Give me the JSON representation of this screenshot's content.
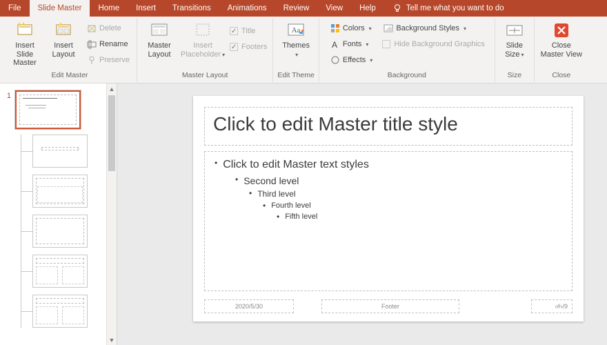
{
  "tabs": {
    "file": "File",
    "slide_master": "Slide Master",
    "home": "Home",
    "insert": "Insert",
    "transitions": "Transitions",
    "animations": "Animations",
    "review": "Review",
    "view": "View",
    "help": "Help",
    "tell_me": "Tell me what you want to do"
  },
  "ribbon": {
    "edit_master": {
      "label": "Edit Master",
      "insert_slide_master": "Insert Slide\nMaster",
      "insert_layout": "Insert\nLayout",
      "delete": "Delete",
      "rename": "Rename",
      "preserve": "Preserve"
    },
    "master_layout": {
      "label": "Master Layout",
      "master_layout_btn": "Master\nLayout",
      "insert_placeholder": "Insert\nPlaceholder",
      "title_chk": "Title",
      "footers_chk": "Footers"
    },
    "edit_theme": {
      "label": "Edit Theme",
      "themes": "Themes"
    },
    "background": {
      "label": "Background",
      "colors": "Colors",
      "fonts": "Fonts",
      "effects": "Effects",
      "bg_styles": "Background Styles",
      "hide_bg": "Hide Background Graphics"
    },
    "size": {
      "label": "Size",
      "slide_size": "Slide\nSize"
    },
    "close": {
      "label": "Close",
      "close_master": "Close\nMaster View"
    }
  },
  "thumbnails": {
    "master_index": "1"
  },
  "slide": {
    "title_ph": "Click to edit Master title style",
    "body_l1": "Click to edit Master text styles",
    "body_l2": "Second level",
    "body_l3": "Third level",
    "body_l4": "Fourth level",
    "body_l5": "Fifth level",
    "date_ph": "2020/5/30",
    "footer_ph": "Footer",
    "number_ph": "‹#›",
    "page_suffix": "/9"
  }
}
